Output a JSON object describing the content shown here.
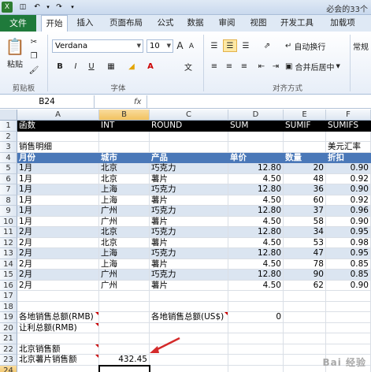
{
  "window": {
    "title": "必会的33个"
  },
  "tabs": [
    {
      "label": "文件"
    },
    {
      "label": "开始"
    },
    {
      "label": "插入"
    },
    {
      "label": "页面布局"
    },
    {
      "label": "公式"
    },
    {
      "label": "数据"
    },
    {
      "label": "审阅"
    },
    {
      "label": "视图"
    },
    {
      "label": "开发工具"
    },
    {
      "label": "加载项"
    }
  ],
  "ribbon": {
    "paste_label": "粘贴",
    "font_name": "Verdana",
    "font_size": "10",
    "bold": "B",
    "italic": "I",
    "underline": "U",
    "wrap_text": "自动换行",
    "merge_center": "合并后居中",
    "number_format": "常规",
    "groups": {
      "clipboard": "剪贴板",
      "font": "字体",
      "alignment": "对齐方式"
    }
  },
  "formula_bar": {
    "name_box": "B24",
    "fx": "fx",
    "value": ""
  },
  "columns": [
    "A",
    "B",
    "C",
    "D",
    "E",
    "F"
  ],
  "rows": [
    {
      "n": "1",
      "cells": [
        "函数",
        "INT",
        "ROUND",
        "SUM",
        "SUMIF",
        "SUMIFS"
      ]
    },
    {
      "n": "2",
      "cells": [
        "",
        "",
        "",
        "",
        "",
        ""
      ]
    },
    {
      "n": "3",
      "cells": [
        "销售明细",
        "",
        "",
        "",
        "",
        "美元汇率"
      ]
    },
    {
      "n": "4",
      "cells": [
        "月份",
        "城市",
        "产品",
        "单价",
        "数量",
        "折扣"
      ]
    },
    {
      "n": "5",
      "cells": [
        "1月",
        "北京",
        "巧克力",
        "12.80",
        "20",
        "0.90"
      ]
    },
    {
      "n": "6",
      "cells": [
        "1月",
        "北京",
        "薯片",
        "4.50",
        "48",
        "0.92"
      ]
    },
    {
      "n": "7",
      "cells": [
        "1月",
        "上海",
        "巧克力",
        "12.80",
        "36",
        "0.90"
      ]
    },
    {
      "n": "8",
      "cells": [
        "1月",
        "上海",
        "薯片",
        "4.50",
        "60",
        "0.92"
      ]
    },
    {
      "n": "9",
      "cells": [
        "1月",
        "广州",
        "巧克力",
        "12.80",
        "37",
        "0.96"
      ]
    },
    {
      "n": "10",
      "cells": [
        "1月",
        "广州",
        "薯片",
        "4.50",
        "58",
        "0.90"
      ]
    },
    {
      "n": "11",
      "cells": [
        "2月",
        "北京",
        "巧克力",
        "12.80",
        "34",
        "0.95"
      ]
    },
    {
      "n": "12",
      "cells": [
        "2月",
        "北京",
        "薯片",
        "4.50",
        "53",
        "0.98"
      ]
    },
    {
      "n": "13",
      "cells": [
        "2月",
        "上海",
        "巧克力",
        "12.80",
        "47",
        "0.95"
      ]
    },
    {
      "n": "14",
      "cells": [
        "2月",
        "上海",
        "薯片",
        "4.50",
        "78",
        "0.85"
      ]
    },
    {
      "n": "15",
      "cells": [
        "2月",
        "广州",
        "巧克力",
        "12.80",
        "90",
        "0.85"
      ]
    },
    {
      "n": "16",
      "cells": [
        "2月",
        "广州",
        "薯片",
        "4.50",
        "62",
        "0.90"
      ]
    },
    {
      "n": "17",
      "cells": [
        "",
        "",
        "",
        "",
        "",
        ""
      ]
    },
    {
      "n": "18",
      "cells": [
        "",
        "",
        "",
        "",
        "",
        ""
      ]
    },
    {
      "n": "19",
      "cells": [
        "各地销售总额(RMB)",
        "",
        "各地销售总额(US$)",
        "0",
        "",
        ""
      ]
    },
    {
      "n": "20",
      "cells": [
        "让利总额(RMB)",
        "",
        "",
        "",
        "",
        ""
      ]
    },
    {
      "n": "21",
      "cells": [
        "",
        "",
        "",
        "",
        "",
        ""
      ]
    },
    {
      "n": "22",
      "cells": [
        "北京销售额",
        "",
        "",
        "",
        "",
        ""
      ]
    },
    {
      "n": "23",
      "cells": [
        "北京薯片销售额",
        "432.45",
        "",
        "",
        "",
        ""
      ]
    },
    {
      "n": "24",
      "cells": [
        "",
        "",
        "",
        "",
        "",
        ""
      ]
    }
  ],
  "watermark": "Bai 经验",
  "colors": {
    "header_black": "#000000",
    "header_blue": "#4a78b8",
    "stripe": "#dbe5f1",
    "arrow": "#d42a2a",
    "file_tab": "#1f7a3b"
  }
}
